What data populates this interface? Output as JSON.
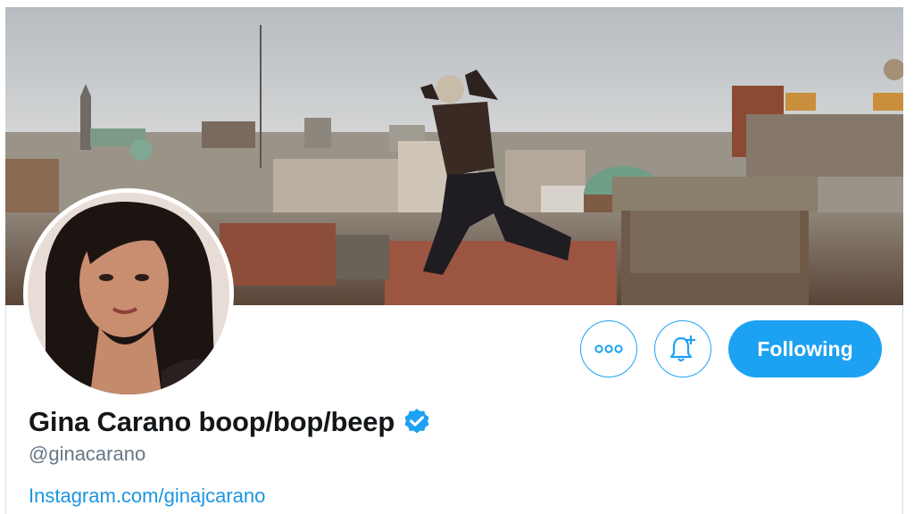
{
  "profile": {
    "display_name": "Gina Carano boop/bop/beep",
    "handle": "@ginacarano",
    "link": "Instagram.com/ginajcarano",
    "verified": true
  },
  "actions": {
    "more_icon": "more-horizontal-icon",
    "notify_icon": "bell-plus-icon",
    "follow_label": "Following"
  },
  "colors": {
    "accent": "#1da1f2",
    "link": "#1b95e0",
    "text": "#14171a",
    "muted": "#657786"
  }
}
